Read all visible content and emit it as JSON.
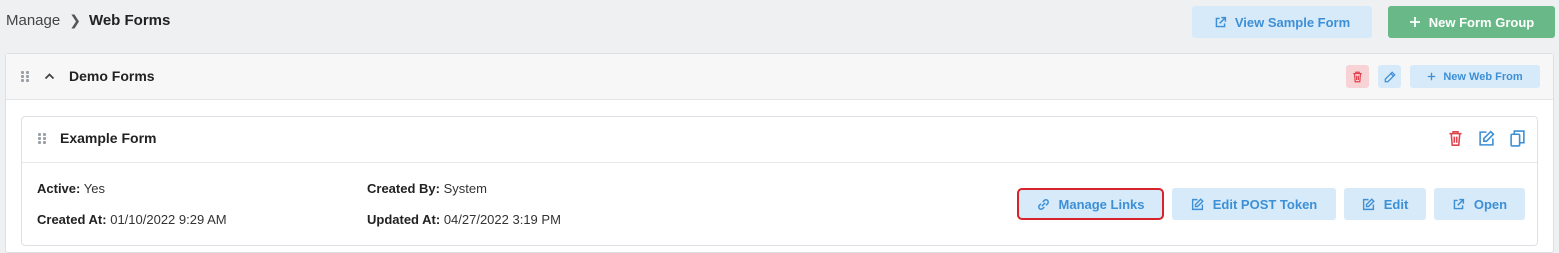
{
  "breadcrumb": {
    "parent": "Manage",
    "current": "Web Forms"
  },
  "toolbar": {
    "view_sample_label": "View Sample Form",
    "new_group_label": "New Form Group"
  },
  "group": {
    "title": "Demo Forms",
    "new_web_form_label": "New Web From"
  },
  "form": {
    "title": "Example Form",
    "active_label": "Active:",
    "active_value": "Yes",
    "created_by_label": "Created By:",
    "created_by_value": "System",
    "created_at_label": "Created At:",
    "created_at_value": "01/10/2022 9:29 AM",
    "updated_at_label": "Updated At:",
    "updated_at_value": "04/27/2022 3:19 PM",
    "actions": {
      "manage_links": "Manage Links",
      "edit_post_token": "Edit POST Token",
      "edit": "Edit",
      "open": "Open"
    }
  },
  "colors": {
    "accent_blue": "#3d8fd6",
    "light_blue": "#d6eaf9",
    "success_green": "#68b987",
    "danger_red": "#e0434e",
    "highlight_red": "#d8232a"
  },
  "icons": [
    "external-link-icon",
    "plus-icon",
    "drag-handle-icon",
    "chevron-up-icon",
    "trash-icon",
    "pencil-icon",
    "edit-icon",
    "copy-icon",
    "link-icon"
  ]
}
